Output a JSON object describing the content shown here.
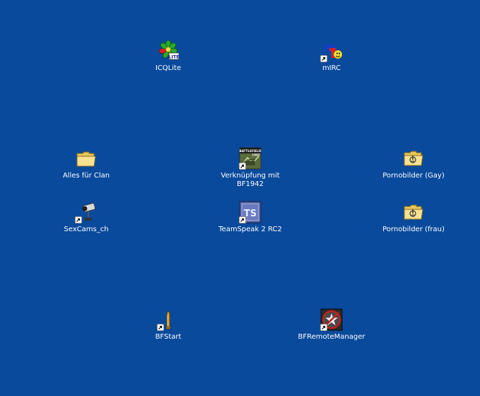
{
  "desktop": {
    "background_color": "#0a4a9c",
    "icons": [
      {
        "label": "ICQLite",
        "icon": "icq-flower-icon",
        "shortcut": false
      },
      {
        "label": "mIRC",
        "icon": "mirc-icon",
        "shortcut": true
      },
      {
        "label": "Alles für Clan",
        "icon": "folder-icon",
        "shortcut": false
      },
      {
        "label": "Verknüpfung mit BF1942",
        "icon": "battlefield-1942-icon",
        "shortcut": true
      },
      {
        "label": "Pornobilder (Gay)",
        "icon": "shared-folder-icon",
        "shortcut": false
      },
      {
        "label": "SexCams_ch",
        "icon": "webcam-icon",
        "shortcut": true
      },
      {
        "label": "TeamSpeak 2 RC2",
        "icon": "teamspeak-icon",
        "shortcut": true
      },
      {
        "label": "Pornobilder (frau)",
        "icon": "shared-folder-icon",
        "shortcut": false
      },
      {
        "label": "BFStart",
        "icon": "bullet-icon",
        "shortcut": true
      },
      {
        "label": "BFRemoteManager",
        "icon": "bf-remote-manager-icon",
        "shortcut": true
      }
    ]
  }
}
